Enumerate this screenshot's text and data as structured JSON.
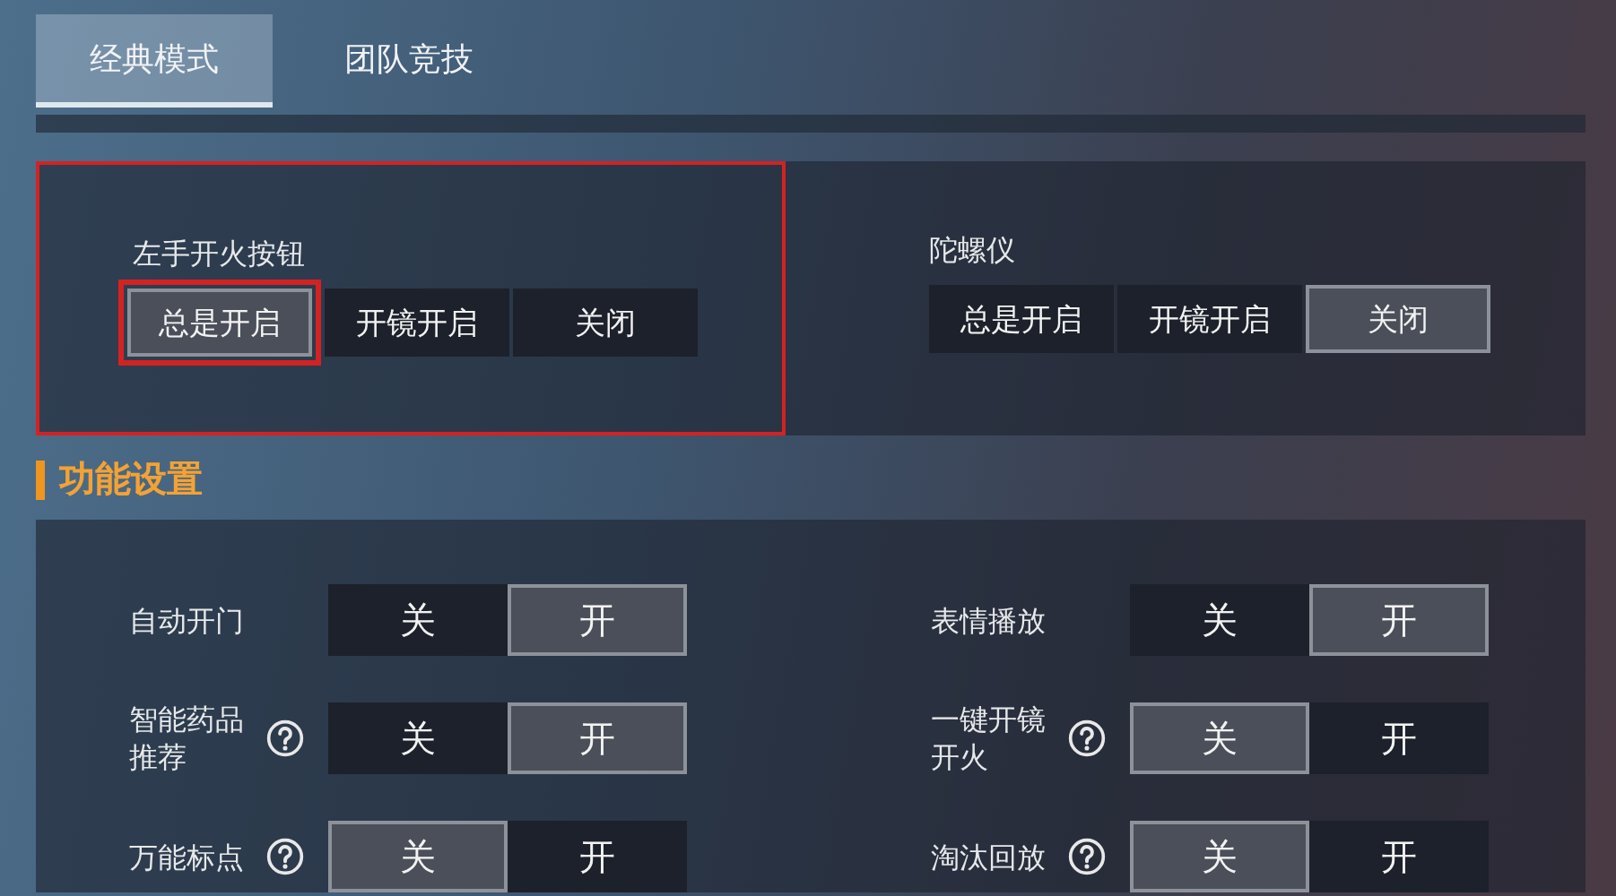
{
  "tabs": [
    {
      "label": "经典模式",
      "selected": true
    },
    {
      "label": "团队竞技",
      "selected": false
    }
  ],
  "fire_panel": {
    "groups": [
      {
        "label": "左手开火按钮",
        "highlighted": true,
        "options": [
          {
            "label": "总是开启",
            "selected": true,
            "highlighted": true
          },
          {
            "label": "开镜开启",
            "selected": false,
            "highlighted": false
          },
          {
            "label": "关闭",
            "selected": false,
            "highlighted": false
          }
        ]
      },
      {
        "label": "陀螺仪",
        "highlighted": false,
        "options": [
          {
            "label": "总是开启",
            "selected": false,
            "highlighted": false
          },
          {
            "label": "开镜开启",
            "selected": false,
            "highlighted": false
          },
          {
            "label": "关闭",
            "selected": true,
            "highlighted": false
          }
        ]
      }
    ]
  },
  "section": {
    "title": "功能设置"
  },
  "toggles": [
    {
      "label": "自动开门",
      "help": false,
      "options": [
        {
          "label": "关",
          "selected": false
        },
        {
          "label": "开",
          "selected": true
        }
      ]
    },
    {
      "label": "表情播放",
      "help": false,
      "options": [
        {
          "label": "关",
          "selected": false
        },
        {
          "label": "开",
          "selected": true
        }
      ]
    },
    {
      "label": "智能药品推荐",
      "help": true,
      "options": [
        {
          "label": "关",
          "selected": false
        },
        {
          "label": "开",
          "selected": true
        }
      ]
    },
    {
      "label": "一键开镜开火",
      "help": true,
      "options": [
        {
          "label": "关",
          "selected": true
        },
        {
          "label": "开",
          "selected": false
        }
      ]
    },
    {
      "label": "万能标点",
      "help": true,
      "options": [
        {
          "label": "关",
          "selected": true
        },
        {
          "label": "开",
          "selected": false
        }
      ]
    },
    {
      "label": "淘汰回放",
      "help": true,
      "options": [
        {
          "label": "关",
          "selected": true
        },
        {
          "label": "开",
          "selected": false
        }
      ]
    }
  ]
}
